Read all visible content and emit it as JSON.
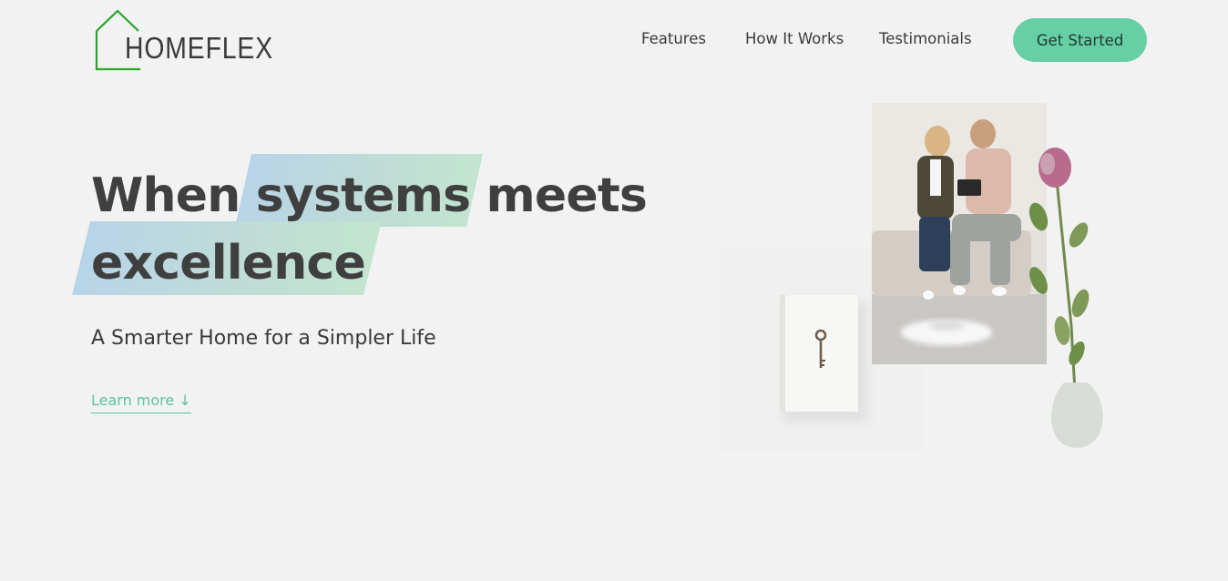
{
  "brand": {
    "name": "HOMEFLEX",
    "accent": "#2aa52a"
  },
  "nav": {
    "links": [
      "Features",
      "How It Works",
      "Testimonials"
    ],
    "cta_label": "Get Started",
    "cta_color": "#66cfa6"
  },
  "hero": {
    "headline_part1": "When ",
    "headline_highlight": "systems",
    "headline_part2": " meets",
    "headline_line2": "excellence",
    "subheading": "A Smarter Home for a Simpler Life",
    "learn_more": "Learn more ↓",
    "learn_more_color": "#5cc49a"
  },
  "images": {
    "left": "book-with-key-photo",
    "right": "couple-with-tablet-and-robot-vacuum-photo",
    "decor": "rose-in-vase-photo"
  }
}
